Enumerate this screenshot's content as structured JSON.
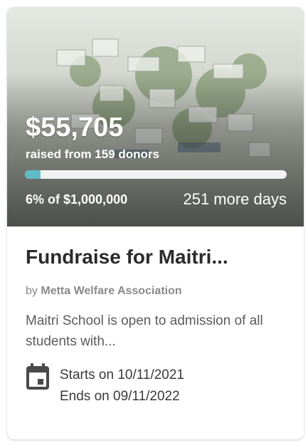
{
  "campaign": {
    "amount_raised": "$55,705",
    "raised_text": "raised from 159 donors",
    "progress_fraction": 0.06,
    "percent_text": "6% of $1,000,000",
    "days_left_text": "251 more days",
    "title": "Fundraise for Maitri...",
    "by_prefix": "by",
    "organizer": "Metta Welfare Association",
    "description": "Maitri School is open to admission of all students with...",
    "starts_text": "Starts on 10/11/2021",
    "ends_text": "Ends on 09/11/2022"
  },
  "colors": {
    "progress_fill": "#5fbcc7",
    "progress_track": "#f2f2f2",
    "title": "#2b2b2b",
    "muted": "#8a8a8a",
    "icon": "#4a4a4a"
  },
  "icons": {
    "calendar": "calendar-icon"
  }
}
